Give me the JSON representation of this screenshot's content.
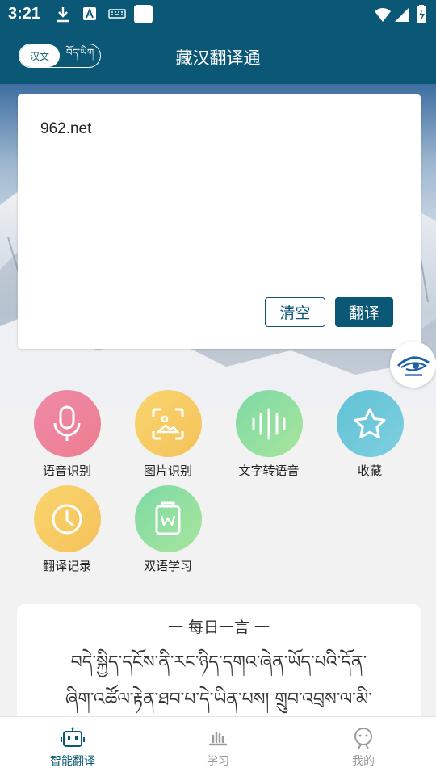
{
  "status_bar": {
    "time": "3:21"
  },
  "header": {
    "title": "藏汉翻译通",
    "lang_toggle": {
      "chinese": "汉文",
      "tibetan": "བོད་ཡིག"
    }
  },
  "input_card": {
    "text": "962.net",
    "clear_label": "清空",
    "translate_label": "翻译"
  },
  "features": [
    {
      "label": "语音识别",
      "icon": "microphone-icon",
      "color": "#ee7e98"
    },
    {
      "label": "图片识别",
      "icon": "image-scan-icon",
      "color": "#f7c65d"
    },
    {
      "label": "文字转语音",
      "icon": "waveform-icon",
      "color": "#7fd7a2"
    },
    {
      "label": "收藏",
      "icon": "star-icon",
      "color": "#6cc6d8"
    },
    {
      "label": "翻译记录",
      "icon": "clock-icon",
      "color": "#f7c65d"
    },
    {
      "label": "双语学习",
      "icon": "book-w-icon",
      "color": "#7fd7a2"
    }
  ],
  "daily": {
    "title": "一  每日一言  一",
    "lines": [
      "བདེ་སྐྱིད་དངོས་ནི་རང་ཉིད་དགའ་ཞེན་ཡོད་པའི་དོན་",
      "ཞིག་འཚོལ་རྟེན་ཐབ་པ་དེ་ཡིན་པས། གྲུབ་འབྲས་ལ་མི་"
    ]
  },
  "bottom_nav": [
    {
      "label": "智能翻译",
      "icon": "robot-icon",
      "active": true
    },
    {
      "label": "学习",
      "icon": "bar-chart-icon",
      "active": false
    },
    {
      "label": "我的",
      "icon": "user-icon",
      "active": false
    }
  ],
  "colors": {
    "primary": "#0b5876",
    "inactive": "#9a9a9a"
  }
}
